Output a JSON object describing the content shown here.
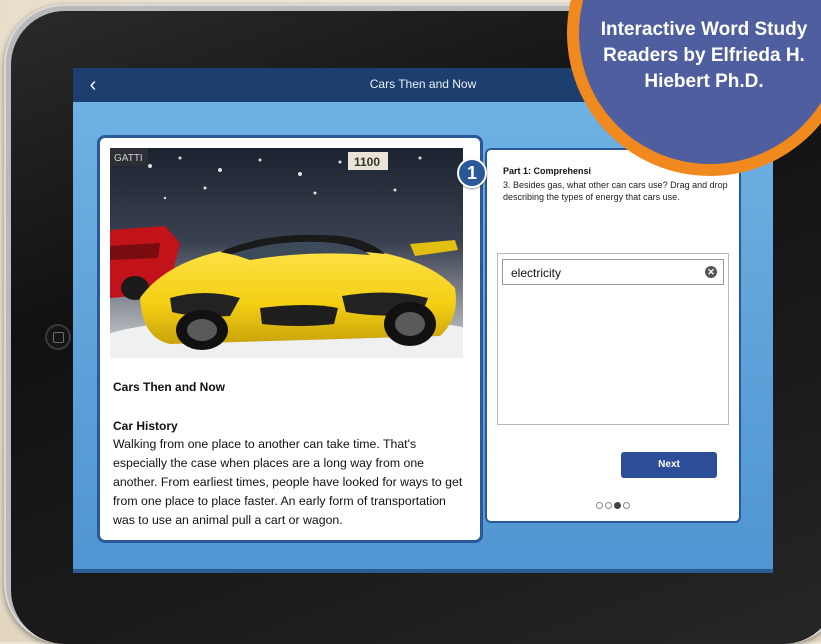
{
  "screen": {
    "title": "Cars Then and Now"
  },
  "reading": {
    "photo_plate": "1100",
    "photo_brand": "GATTI",
    "story_title": "Cars Then and Now",
    "section_heading": "Car History",
    "body": "Walking from one place to another can take time. That's especially the case when places are a long way from one another. From earliest times, people have looked for ways to get from one place to place faster. An early form of transportation was to use an animal pull a cart or wagon."
  },
  "question": {
    "step_number": "1",
    "part_heading": "Part 1: Comprehensi",
    "text": "3. Besides gas, what other can cars use? Drag and drop describing the types of energy that cars use.",
    "answers": [
      "electricity"
    ],
    "next_label": "Next",
    "pager": {
      "total": 4,
      "current": 3
    }
  },
  "promo": {
    "text": "Interactive Word Study Readers by Elfrieda H. Hiebert Ph.D."
  },
  "colors": {
    "navbar": "#1d3f6f",
    "screen_bg": "#5fa3db",
    "card_border": "#2a5898",
    "next_button": "#2c4d97",
    "promo_ring": "#f08a1f",
    "promo_fill": "#4f5e9e",
    "car_yellow": "#f3cf14"
  },
  "icons": {
    "back": "chevron-left-icon",
    "remove": "close-circle-icon",
    "home": "home-button-icon"
  }
}
